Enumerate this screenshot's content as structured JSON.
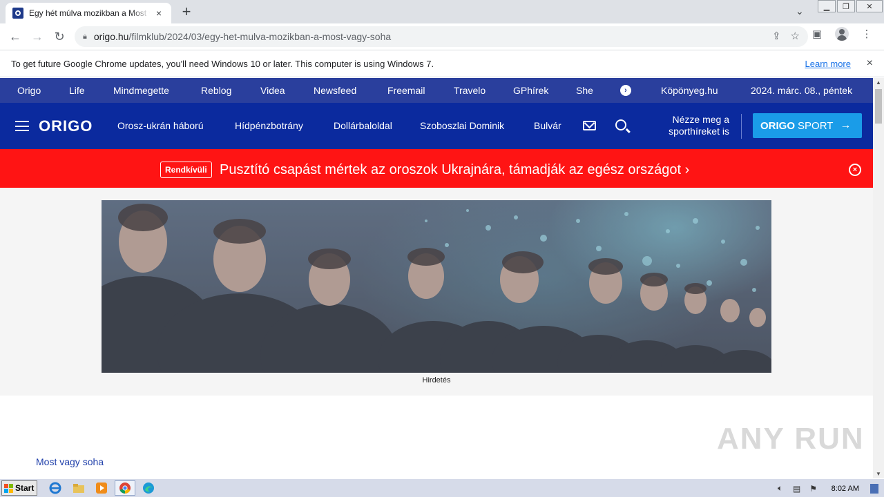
{
  "browser": {
    "tab_title": "Egy hét múlva mozikban a Most vagy soha",
    "tab_close": "×",
    "new_tab": "+",
    "url_host": "origo.hu",
    "url_path": "/filmklub/2024/03/egy-het-mulva-mozikban-a-most-vagy-soha",
    "infobar_message": "To get future Google Chrome updates, you'll need Windows 10 or later. This computer is using Windows 7.",
    "infobar_link": "Learn more",
    "infobar_close": "×"
  },
  "topnav": {
    "items": [
      "Origo",
      "Life",
      "Mindmegette",
      "Reblog",
      "Videa",
      "Newsfeed",
      "Freemail",
      "Travelo",
      "GPhírek",
      "She"
    ],
    "more_symbol": "›",
    "weather": "Köpönyeg.hu",
    "date": "2024. márc. 08., péntek"
  },
  "mainnav": {
    "logo": "ORIGO",
    "links": [
      "Orosz-ukrán háború",
      "Hídpénzbotrány",
      "Dollárbaloldal",
      "Szoboszlai Dominik",
      "Bulvár"
    ],
    "promo_line1": "Nézze meg a",
    "promo_line2": "sporthíreket is",
    "sport_button_bold": "ORIGO",
    "sport_button_light": "SPORT",
    "sport_arrow": "→"
  },
  "breaking": {
    "badge": "Rendkívüli",
    "headline": "Pusztító csapást mértek az oroszok Ukrajnára, támadják az egész országot ›",
    "close": "×"
  },
  "ad": {
    "caption": "Hirdetés"
  },
  "article": {
    "breadcrumb_link": "Most vagy soha"
  },
  "watermark": "ANY RUN",
  "taskbar": {
    "start_label": "Start",
    "clock": "8:02 AM"
  },
  "colors": {
    "topnav_bg": "#2a3f9d",
    "mainnav_bg": "#0b2a9e",
    "breaking_bg": "#ff1414",
    "sport_button_bg": "#1a9ce8"
  },
  "icons": [
    "origo-favicon",
    "back-icon",
    "forward-icon",
    "reload-icon",
    "lock-icon",
    "share-icon",
    "star-icon",
    "sidepanel-icon",
    "profile-icon",
    "menu-icon",
    "hamburger-icon",
    "mail-icon",
    "search-icon",
    "circle-close-icon",
    "windows-flag-icon",
    "ie-icon",
    "explorer-icon",
    "media-player-icon",
    "chrome-icon",
    "edge-icon",
    "volume-icon",
    "network-icon",
    "action-center-icon"
  ]
}
